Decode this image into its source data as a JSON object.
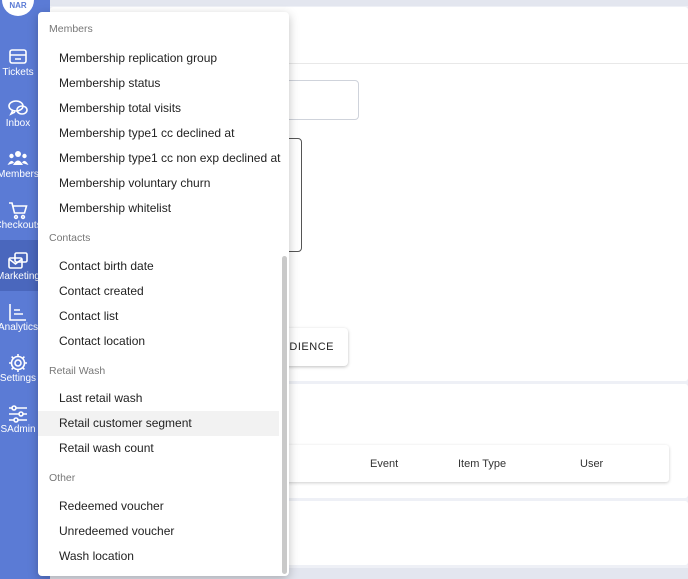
{
  "sidebar": {
    "logo_text": "NAR",
    "items": [
      {
        "label": "Tickets",
        "icon": "ticket-icon"
      },
      {
        "label": "Inbox",
        "icon": "chat-icon"
      },
      {
        "label": "Members",
        "icon": "members-icon"
      },
      {
        "label": "Checkouts",
        "icon": "cart-icon"
      },
      {
        "label": "Marketing",
        "icon": "marketing-icon",
        "active": true
      },
      {
        "label": "Analytics",
        "icon": "analytics-icon"
      },
      {
        "label": "Settings",
        "icon": "gear-icon"
      },
      {
        "label": "SAdmin",
        "icon": "sliders-icon"
      }
    ]
  },
  "main": {
    "audience_button": "UDIENCE",
    "table_headers": [
      "Event",
      "Item Type",
      "User"
    ]
  },
  "dropdown": {
    "groups": [
      {
        "header": "Members",
        "options": [
          "Membership replication group",
          "Membership status",
          "Membership total visits",
          "Membership type1 cc declined at",
          "Membership type1 cc non exp declined at",
          "Membership voluntary churn",
          "Membership whitelist"
        ]
      },
      {
        "header": "Contacts",
        "options": [
          "Contact birth date",
          "Contact created",
          "Contact list",
          "Contact location"
        ]
      },
      {
        "header": "Retail Wash",
        "options": [
          "Last retail wash",
          "Retail customer segment",
          "Retail wash count"
        ]
      },
      {
        "header": "Other",
        "options": [
          "Redeemed voucher",
          "Unredeemed voucher",
          "Wash location"
        ]
      }
    ],
    "highlighted_option": "Retail customer segment"
  },
  "colors": {
    "sidebar": "#5b7bd5",
    "sidebar_active": "#4a67bd",
    "highlight": "#f2f2f2"
  }
}
